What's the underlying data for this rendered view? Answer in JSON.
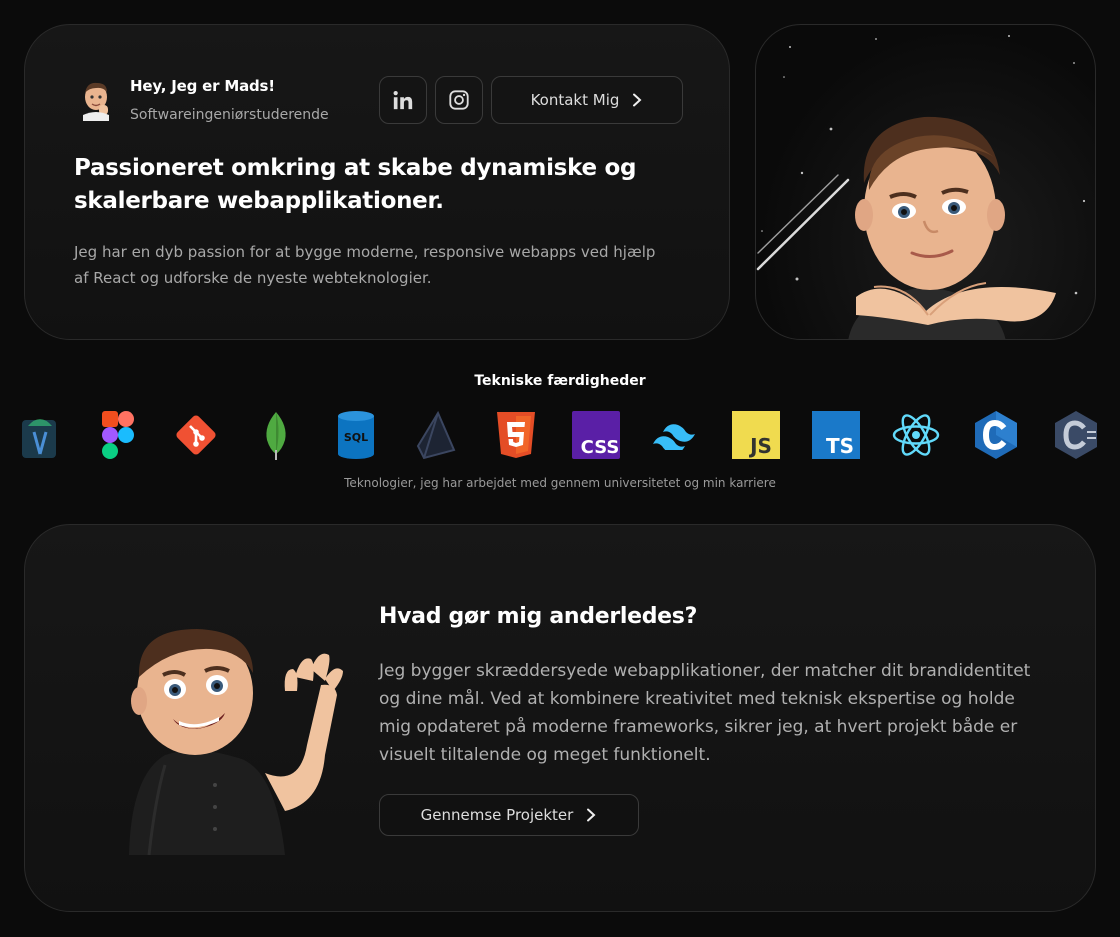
{
  "hero": {
    "greeting": "Hey, Jeg er Mads!",
    "role": "Softwareingeniørstuderende",
    "contact_label": "Kontakt Mig",
    "headline": "Passioneret omkring at skabe dynamiske og skalerbare webapplikationer.",
    "lead": "Jeg har en dyb passion for at bygge moderne, responsive webapps ved hjælp af React og udforske de nyeste webteknologier."
  },
  "skills": {
    "title": "Tekniske færdigheder",
    "subtitle": "Teknologier, jeg har arbejdet med gennem universitetet og min karriere",
    "items": [
      "android-studio-icon",
      "figma-icon",
      "git-icon",
      "mongodb-icon",
      "sql-icon",
      "prisma-icon",
      "html5-icon",
      "css-icon",
      "tailwind-icon",
      "javascript-icon",
      "typescript-icon",
      "react-icon",
      "c-icon",
      "csharp-icon"
    ]
  },
  "diff": {
    "title": "Hvad gør mig anderledes?",
    "text": "Jeg bygger skræddersyede webapplikationer, der matcher dit brandidentitet og dine mål. Ved at kombinere kreativitet med teknisk ekspertise og holde mig opdateret på moderne frameworks, sikrer jeg, at hvert projekt både er visuelt tiltalende og meget funktionelt.",
    "button_label": "Gennemse Projekter"
  },
  "colors": {
    "background": "#0b0b0b",
    "card": "#151515",
    "border": "#2a2a2a",
    "muted": "#a8a8a8"
  }
}
